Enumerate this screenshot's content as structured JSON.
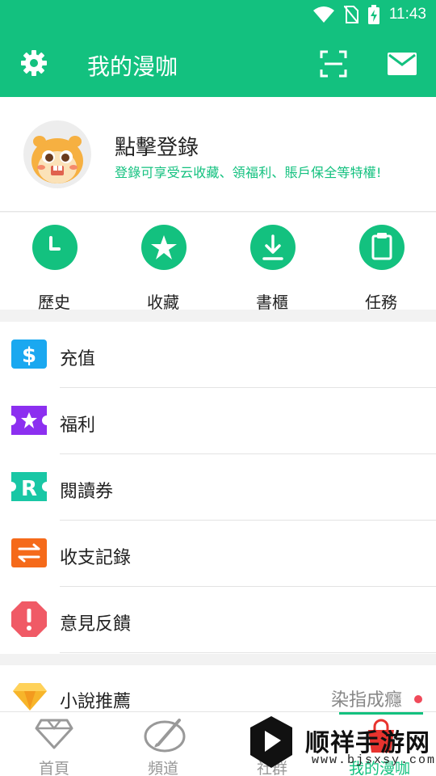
{
  "status_bar": {
    "time": "11:43",
    "icons": [
      "wifi-icon",
      "no-sim-icon",
      "battery-charging-icon"
    ]
  },
  "app_bar": {
    "title": "我的漫咖",
    "left_icon": "gear-icon",
    "right_icons": [
      "scan-icon",
      "mail-icon"
    ]
  },
  "profile": {
    "title": "點擊登錄",
    "subtitle": "登錄可享受云收藏、領福利、賬戶保全等特權!"
  },
  "quick_actions": [
    {
      "label": "歷史",
      "icon": "clock-icon"
    },
    {
      "label": "收藏",
      "icon": "star-icon"
    },
    {
      "label": "書櫃",
      "icon": "download-icon"
    },
    {
      "label": "任務",
      "icon": "clipboard-icon"
    }
  ],
  "menu": [
    {
      "label": "充值",
      "icon": "dollar-icon",
      "color": "#1aa8f0"
    },
    {
      "label": "福利",
      "icon": "star-ticket-icon",
      "color": "#8c2ff0"
    },
    {
      "label": "閱讀券",
      "icon": "r-ticket-icon",
      "color": "#19c7a5"
    },
    {
      "label": "收支記錄",
      "icon": "exchange-icon",
      "color": "#f56a1a"
    },
    {
      "label": "意見反饋",
      "icon": "warning-octagon-icon",
      "color": "#f05a66"
    }
  ],
  "novel": {
    "label": "小說推薦",
    "icon": "diamond-icon",
    "side_label": "染指成癮"
  },
  "tabs": [
    {
      "label": "首頁",
      "icon": "diamond-outline-icon",
      "active": false
    },
    {
      "label": "頻道",
      "icon": "palette-icon",
      "active": false
    },
    {
      "label": "社群",
      "icon": "community-icon",
      "active": false
    },
    {
      "label": "我的漫咖",
      "icon": "bag-icon",
      "active": true
    }
  ],
  "watermark": {
    "text": "顺祥手游网",
    "url": "www.bjsxsy.com"
  },
  "colors": {
    "primary": "#13c17f",
    "text": "#222222",
    "muted": "#999999"
  }
}
